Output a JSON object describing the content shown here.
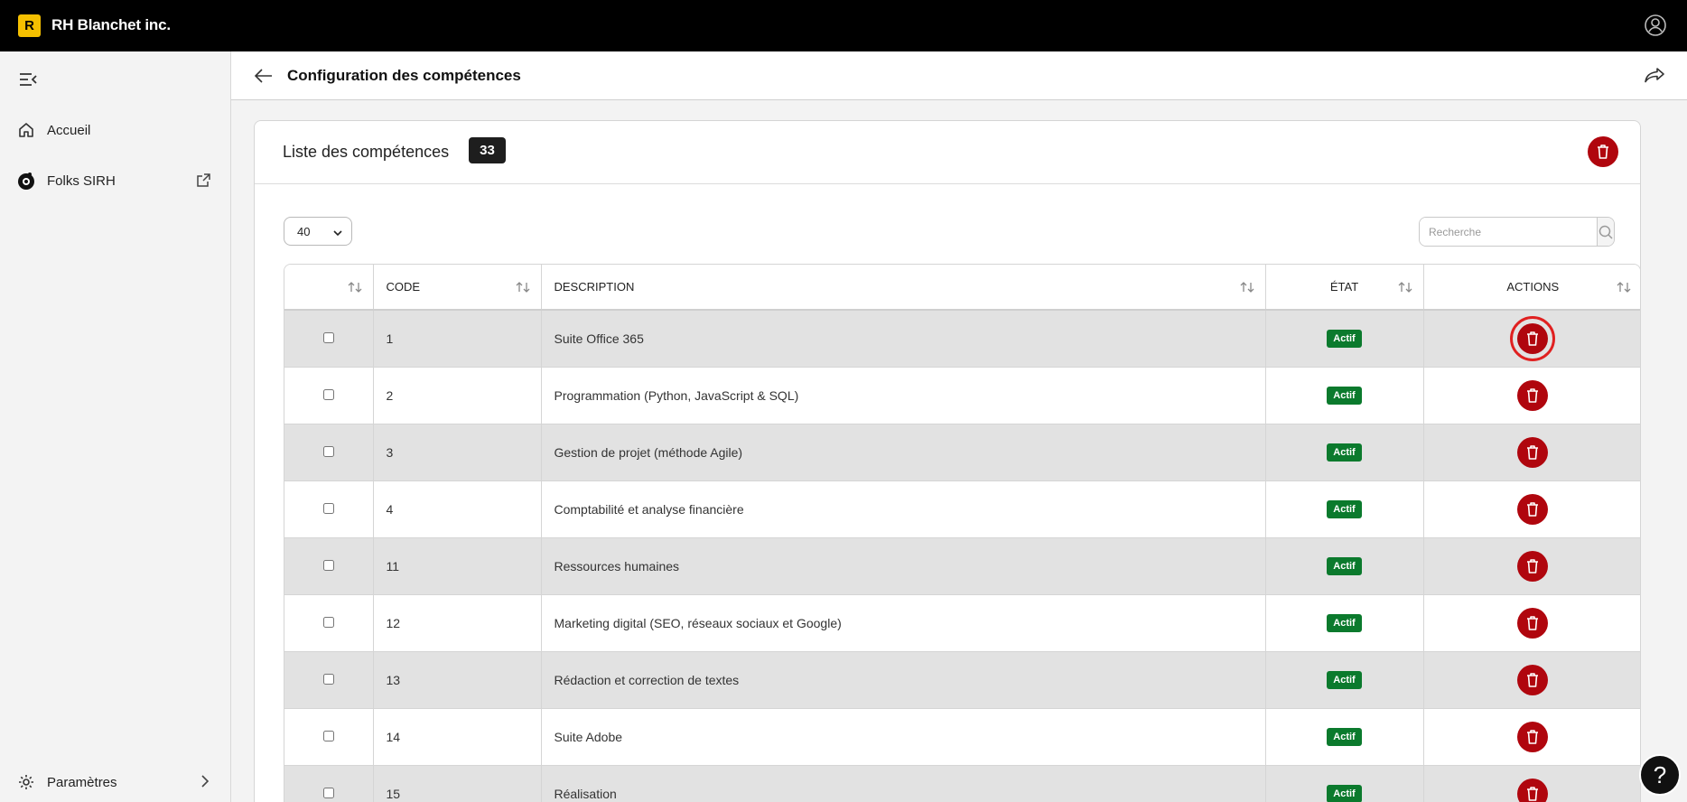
{
  "app": {
    "logo_letter": "R",
    "brand": "RH Blanchet inc."
  },
  "sidebar": {
    "items": [
      {
        "label": "Accueil"
      },
      {
        "label": "Folks SIRH"
      }
    ],
    "settings_label": "Paramètres"
  },
  "header": {
    "title": "Configuration des compétences"
  },
  "card": {
    "title": "Liste des compétences",
    "count": "33",
    "page_size": "40",
    "search_placeholder": "Recherche"
  },
  "table": {
    "columns": [
      "",
      "CODE",
      "DESCRIPTION",
      "ÉTAT",
      "ACTIONS"
    ],
    "rows": [
      {
        "code": "1",
        "description": "Suite Office 365",
        "etat": "Actif"
      },
      {
        "code": "2",
        "description": "Programmation (Python, JavaScript & SQL)",
        "etat": "Actif"
      },
      {
        "code": "3",
        "description": "Gestion de projet (méthode Agile)",
        "etat": "Actif"
      },
      {
        "code": "4",
        "description": "Comptabilité et analyse financière",
        "etat": "Actif"
      },
      {
        "code": "11",
        "description": "Ressources humaines",
        "etat": "Actif"
      },
      {
        "code": "12",
        "description": "Marketing digital (SEO, réseaux sociaux et Google)",
        "etat": "Actif"
      },
      {
        "code": "13",
        "description": "Rédaction et correction de textes",
        "etat": "Actif"
      },
      {
        "code": "14",
        "description": "Suite Adobe",
        "etat": "Actif"
      },
      {
        "code": "15",
        "description": "Réalisation",
        "etat": "Actif"
      }
    ]
  },
  "help": {
    "label": "?"
  },
  "colors": {
    "accent_delete": "#b0060e",
    "status_active": "#0b7a2d",
    "topbar": "#000000",
    "logo": "#f5c000"
  }
}
